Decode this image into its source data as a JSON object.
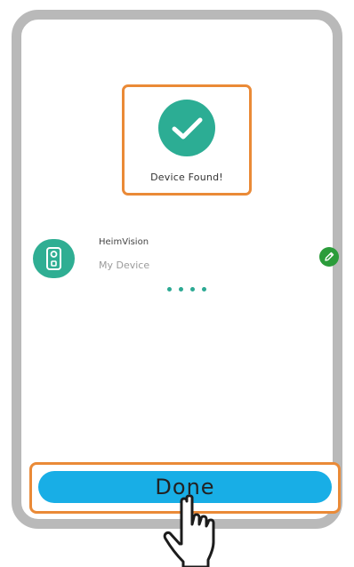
{
  "status": {
    "found_label": "Device Found!",
    "icon": "check-icon"
  },
  "device": {
    "brand": "HeimVision",
    "name": "My Device",
    "icon": "camera-device-icon",
    "edit_icon": "pencil-icon"
  },
  "progress": {
    "dots": 4
  },
  "actions": {
    "done_label": "Done"
  },
  "colors": {
    "accent_teal": "#2cad94",
    "highlight_orange": "#ea8a37",
    "done_blue": "#18aee6",
    "edit_green": "#2b9c3a"
  }
}
